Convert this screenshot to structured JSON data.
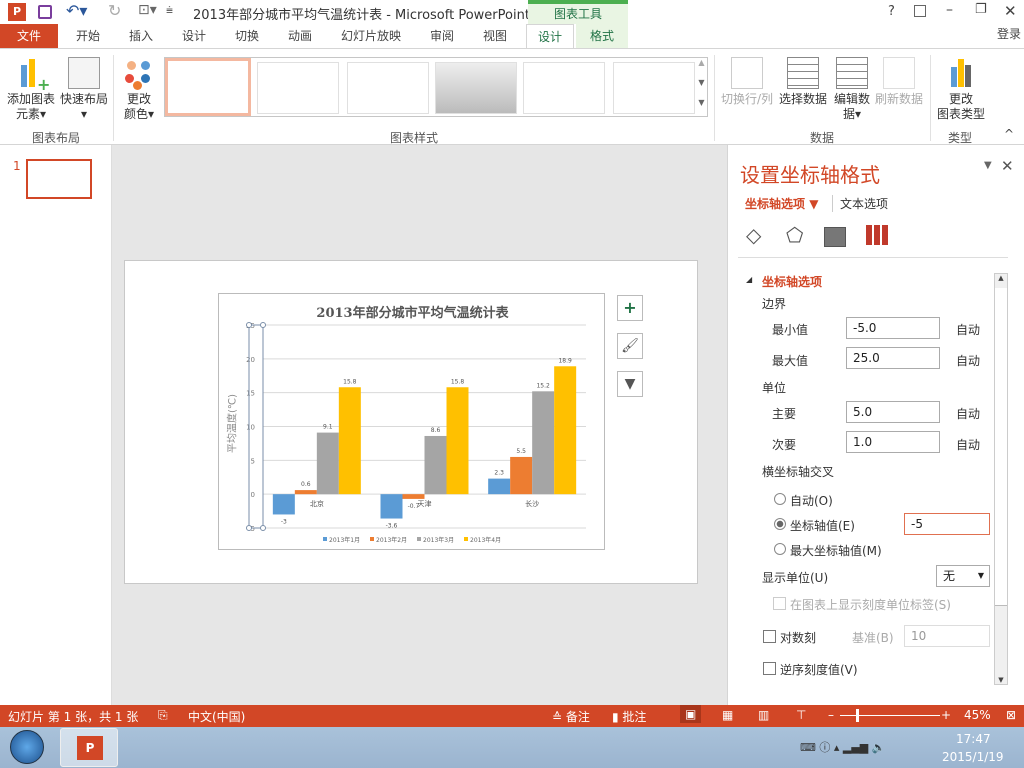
{
  "window": {
    "title": "2013年部分城市平均气温统计表 - Microsoft PowerPoint",
    "context_tab_group": "图表工具",
    "help": "?",
    "login": "登录"
  },
  "tabs": [
    "文件",
    "开始",
    "插入",
    "设计",
    "切换",
    "动画",
    "幻灯片放映",
    "审阅",
    "视图",
    "设计",
    "格式"
  ],
  "active_tab": "设计",
  "ribbon": {
    "groups": {
      "layout": "图表布局",
      "styles": "图表样式",
      "data": "数据",
      "type": "类型"
    },
    "buttons": {
      "add_element": [
        "添加图表",
        "元素"
      ],
      "quick_layout": [
        "快速布局",
        ""
      ],
      "change_colors": [
        "更改",
        "颜色"
      ],
      "switch_row_col": "切换行/列",
      "select_data": "选择数据",
      "edit_data": [
        "编辑数",
        "据"
      ],
      "refresh_data": "刷新数据",
      "change_type": [
        "更改",
        "图表类型"
      ]
    }
  },
  "slides": {
    "current_number": "1"
  },
  "chart_data": {
    "type": "bar",
    "title": "2013年部分城市平均气温统计表",
    "ylabel": "平均温度(℃)",
    "xlabel": "",
    "categories": [
      "北京",
      "天津",
      "长沙"
    ],
    "series": [
      {
        "name": "2013年1月",
        "values": [
          -3,
          -3.6,
          2.3
        ],
        "color": "#5b9bd5"
      },
      {
        "name": "2013年2月",
        "values": [
          0.6,
          -0.7,
          5.5
        ],
        "color": "#ed7d31"
      },
      {
        "name": "2013年3月",
        "values": [
          9.1,
          8.6,
          15.2
        ],
        "color": "#a5a5a5"
      },
      {
        "name": "2013年4月",
        "values": [
          15.8,
          15.8,
          18.9
        ],
        "color": "#ffc000"
      }
    ],
    "ylim": [
      -5,
      25
    ],
    "yticks": [
      -5,
      0,
      5,
      10,
      15,
      20,
      25
    ],
    "grid": true,
    "legend": "bottom"
  },
  "pane": {
    "title": "设置坐标轴格式",
    "tab_axis": "坐标轴选项",
    "tab_text": "文本选项",
    "section": "坐标轴选项",
    "bounds": "边界",
    "min_label": "最小值",
    "min_value": "-5.0",
    "max_label": "最大值",
    "max_value": "25.0",
    "units": "单位",
    "major_label": "主要",
    "major_value": "5.0",
    "minor_label": "次要",
    "minor_value": "1.0",
    "auto": "自动",
    "cross": "横坐标轴交叉",
    "cross_auto": "自动(O)",
    "cross_value": "坐标轴值(E)",
    "cross_value_input": "-5",
    "cross_max": "最大坐标轴值(M)",
    "display_units": "显示单位(U)",
    "display_units_value": "无",
    "show_units_label": "在图表上显示刻度单位标签(S)",
    "log_scale": "对数刻",
    "base_label": "基准(B)",
    "base_value": "10",
    "reverse": "逆序刻度值(V)"
  },
  "status": {
    "slide_info": "幻灯片 第 1 张，共 1 张",
    "language": "中文(中国)",
    "notes": "备注",
    "comments": "批注",
    "zoom": "45%"
  },
  "taskbar": {
    "time": "17:47",
    "date": "2015/1/19"
  },
  "colors": {
    "accent": "#d24726",
    "context": "#217346"
  }
}
